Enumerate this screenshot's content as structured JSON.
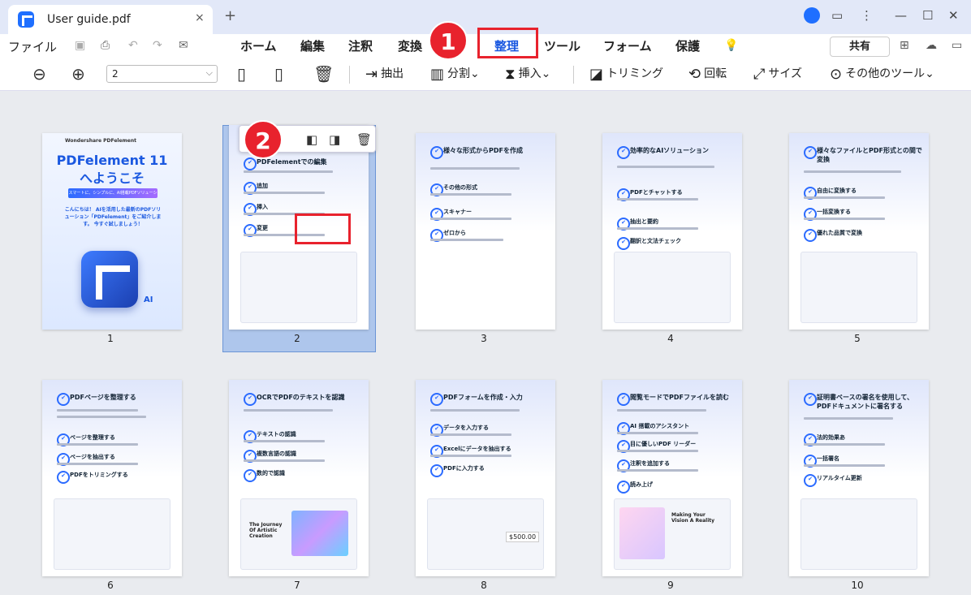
{
  "window": {
    "tab_title": "User guide.pdf",
    "close_glyph": "×",
    "newtab_glyph": "+"
  },
  "menubar": {
    "file_label": "ファイル",
    "tabs": [
      "ホーム",
      "編集",
      "注釈",
      "変換",
      "整理",
      "ツール",
      "フォーム",
      "保護"
    ],
    "active_tab": "整理",
    "share_label": "共有"
  },
  "toolbar": {
    "page_value": "2",
    "extract_label": "抽出",
    "split_label": "分割",
    "insert_label": "挿入",
    "crop_label": "トリミング",
    "rotate_label": "回転",
    "size_label": "サイズ",
    "more_label": "その他のツール"
  },
  "annotations": {
    "step1": "1",
    "step2": "2"
  },
  "pages": [
    {
      "num": "1",
      "brand": "Wondershare PDFelement",
      "title1": "PDFelement 11",
      "title2": "へようこそ",
      "banner": "スマートに、シンプルに、AI搭載PDFソリューション",
      "tagline": "こんにちは！ AIを活用した最新のPDFソリューション「PDFelement」をご紹介します。 今すぐ試しましょう！",
      "ai": "AI"
    },
    {
      "num": "2",
      "heading": "PDFelementでの編集",
      "items": [
        "追加",
        "挿入",
        "変更"
      ]
    },
    {
      "num": "3",
      "heading": "様々な形式からPDFを作成",
      "items": [
        "その他の形式",
        "スキャナー",
        "ゼロから"
      ]
    },
    {
      "num": "4",
      "heading": "効率的なAIソリューション",
      "items": [
        "PDFとチャットする",
        "抽出と要約",
        "翻訳と文法チェック"
      ]
    },
    {
      "num": "5",
      "heading": "様々なファイルとPDF形式との間で変換",
      "items": [
        "自由に変換する",
        "一括変換する",
        "優れた品質で変換"
      ]
    },
    {
      "num": "6",
      "heading": "PDFページを整理する",
      "items": [
        "ページを整理する",
        "ページを抽出する",
        "PDFをトリミングする"
      ]
    },
    {
      "num": "7",
      "heading": "OCRでPDFのテキストを認識",
      "items": [
        "テキストの認識",
        "複数言語の認識",
        "数的で認識"
      ],
      "shot_title": "The Journey Of Artistic Creation"
    },
    {
      "num": "8",
      "heading": "PDFフォームを作成・入力",
      "items": [
        "データを入力する",
        "Excelにデータを抽出する",
        "PDFに入力する"
      ],
      "price": "$500.00"
    },
    {
      "num": "9",
      "heading": "閲覧モードでPDFファイルを読む",
      "items": [
        "AI 搭載のアシスタント",
        "目に優しいPDF リーダー",
        "注釈を追加する",
        "読み上げ"
      ],
      "shot_title": "Making Your Vision A Reality"
    },
    {
      "num": "10",
      "heading": "証明書ベースの署名を使用して、PDFドキュメントに署名する",
      "items": [
        "法的効果あ",
        "一括署名",
        "リアルタイム更新"
      ]
    }
  ]
}
